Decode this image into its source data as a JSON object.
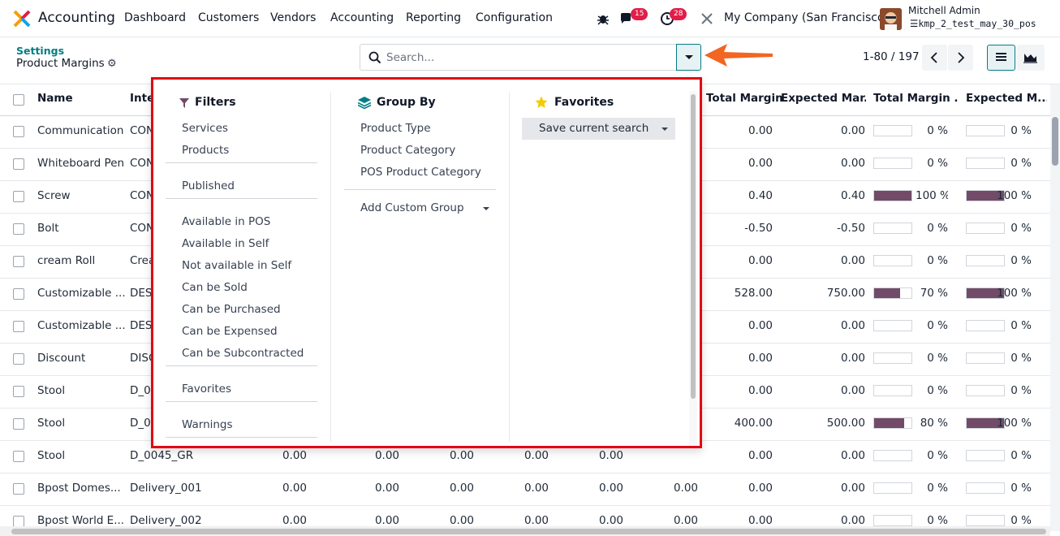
{
  "app": {
    "name": "Accounting"
  },
  "menu": [
    "Dashboard",
    "Customers",
    "Vendors",
    "Accounting",
    "Reporting",
    "Configuration"
  ],
  "systray": {
    "messages_count": "15",
    "activities_count": "28",
    "company": "My Company (San Francisco)",
    "user_name": "Mitchell Admin",
    "database": "kmp_2_test_may_30_pos"
  },
  "breadcrumb": {
    "parent": "Settings",
    "current": "Product Margins"
  },
  "search": {
    "placeholder": "Search..."
  },
  "pager": {
    "value": "1-80 / 197"
  },
  "columns": [
    "Name",
    "Inte",
    "Total Margin",
    "Expected Mar...",
    "Total Margin ...",
    "Expected M..."
  ],
  "rows": [
    {
      "name": "Communication",
      "ref": "CON",
      "vals": [
        "",
        "",
        "",
        "",
        ""
      ],
      "total_margin": "0.00",
      "expected_margin": "0.00",
      "tm_pct": 0,
      "tm_label": "0 %",
      "em_pct": 0,
      "em_label": "0 %"
    },
    {
      "name": "Whiteboard Pen",
      "ref": "CON",
      "vals": [
        "",
        "",
        "",
        "",
        ""
      ],
      "total_margin": "0.00",
      "expected_margin": "0.00",
      "tm_pct": 0,
      "tm_label": "0 %",
      "em_pct": 0,
      "em_label": "0 %"
    },
    {
      "name": "Screw",
      "ref": "CON",
      "vals": [
        "",
        "",
        "",
        "",
        ""
      ],
      "total_margin": "0.40",
      "expected_margin": "0.40",
      "tm_pct": 100,
      "tm_label": "100 %",
      "em_pct": 100,
      "em_label": "100 %"
    },
    {
      "name": "Bolt",
      "ref": "CON",
      "vals": [
        "",
        "",
        "",
        "",
        ""
      ],
      "total_margin": "-0.50",
      "expected_margin": "-0.50",
      "tm_pct": 0,
      "tm_label": "0 %",
      "em_pct": 0,
      "em_label": "0 %"
    },
    {
      "name": "cream Roll",
      "ref": "Crea",
      "vals": [
        "",
        "",
        "",
        "",
        ""
      ],
      "total_margin": "0.00",
      "expected_margin": "0.00",
      "tm_pct": 0,
      "tm_label": "0 %",
      "em_pct": 0,
      "em_label": "0 %"
    },
    {
      "name": "Customizable ...",
      "ref": "DES",
      "vals": [
        "",
        "",
        "",
        "",
        ""
      ],
      "total_margin": "528.00",
      "expected_margin": "750.00",
      "tm_pct": 70,
      "tm_label": "70 %",
      "em_pct": 100,
      "em_label": "100 %"
    },
    {
      "name": "Customizable ...",
      "ref": "DES",
      "vals": [
        "",
        "",
        "",
        "",
        ""
      ],
      "total_margin": "0.00",
      "expected_margin": "0.00",
      "tm_pct": 0,
      "tm_label": "0 %",
      "em_pct": 0,
      "em_label": "0 %"
    },
    {
      "name": "Discount",
      "ref": "DISC",
      "vals": [
        "",
        "",
        "",
        "",
        ""
      ],
      "total_margin": "0.00",
      "expected_margin": "0.00",
      "tm_pct": 0,
      "tm_label": "0 %",
      "em_pct": 0,
      "em_label": "0 %"
    },
    {
      "name": "Stool",
      "ref": "D_0",
      "vals": [
        "",
        "",
        "",
        "",
        ""
      ],
      "total_margin": "0.00",
      "expected_margin": "0.00",
      "tm_pct": 0,
      "tm_label": "0 %",
      "em_pct": 0,
      "em_label": "0 %"
    },
    {
      "name": "Stool",
      "ref": "D_0",
      "vals": [
        "",
        "",
        "",
        "",
        ""
      ],
      "total_margin": "400.00",
      "expected_margin": "500.00",
      "tm_pct": 80,
      "tm_label": "80 %",
      "em_pct": 100,
      "em_label": "100 %"
    },
    {
      "name": "Stool",
      "ref": "D_0045_GR",
      "vals": [
        "0.00",
        "0.00",
        "0.00",
        "0.00",
        "0.00"
      ],
      "total_margin": "0.00",
      "expected_margin": "0.00",
      "tm_pct": 0,
      "tm_label": "0 %",
      "em_pct": 0,
      "em_label": "0 %"
    },
    {
      "name": "Bpost Domes...",
      "ref": "Delivery_001",
      "vals": [
        "0.00",
        "0.00",
        "0.00",
        "0.00",
        "0.00"
      ],
      "extra": "0.00",
      "total_margin": "0.00",
      "expected_margin": "0.00",
      "tm_pct": 0,
      "tm_label": "0 %",
      "em_pct": 0,
      "em_label": "0 %"
    },
    {
      "name": "Bpost World E...",
      "ref": "Delivery_002",
      "vals": [
        "0.00",
        "0.00",
        "0.00",
        "0.00",
        "0.00"
      ],
      "extra": "0.00",
      "total_margin": "0.00",
      "expected_margin": "0.00",
      "tm_pct": 0,
      "tm_label": "0 %",
      "em_pct": 0,
      "em_label": "0 %"
    }
  ],
  "filters": {
    "heading": "Filters",
    "groups": [
      [
        "Services",
        "Products"
      ],
      [
        "Published"
      ],
      [
        "Available in POS",
        "Available in Self",
        "Not available in Self",
        "Can be Sold",
        "Can be Purchased",
        "Can be Expensed",
        "Can be Subcontracted"
      ],
      [
        "Favorites"
      ],
      [
        "Warnings"
      ]
    ]
  },
  "group_by": {
    "heading": "Group By",
    "options": [
      "Product Type",
      "Product Category",
      "POS Product Category"
    ],
    "custom": "Add Custom Group"
  },
  "favorites": {
    "heading": "Favorites",
    "save_label": "Save current search"
  },
  "colors": {
    "accent": "#017e84",
    "brand": "#714b67",
    "highlight_border": "#e30613",
    "annotation_arrow": "#f26522"
  }
}
